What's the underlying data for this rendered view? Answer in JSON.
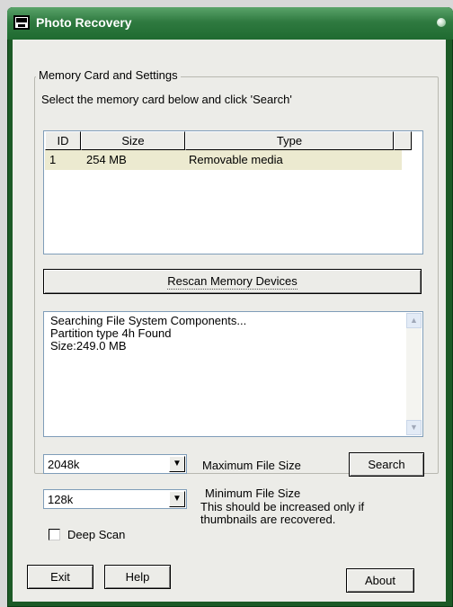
{
  "window": {
    "title": "Photo Recovery"
  },
  "group": {
    "legend": "Memory Card and Settings",
    "instruction": "Select the memory card below and click 'Search'"
  },
  "device_list": {
    "columns": [
      "ID",
      "Size",
      "Type"
    ],
    "rows": [
      {
        "id": "1",
        "size": "254 MB",
        "type": "Removable media"
      }
    ]
  },
  "rescan_button": "Rescan Memory Devices",
  "log": {
    "lines": [
      "Searching File System Components...",
      "Partition type  4h Found",
      "Size:249.0 MB"
    ]
  },
  "max_file_size": {
    "value": "2048k",
    "label": "Maximum File Size"
  },
  "min_file_size": {
    "value": "128k",
    "label": "Minimum File Size",
    "note_line1": "This should be increased only if",
    "note_line2": "thumbnails are recovered."
  },
  "deep_scan": {
    "label": "Deep Scan",
    "checked": false
  },
  "buttons": {
    "search": "Search",
    "exit": "Exit",
    "help": "Help",
    "about": "About"
  },
  "colors": {
    "titlebar": "#2f7a40",
    "frame": "#1c5a26",
    "client": "#ecece8",
    "selected_row": "#ecead0"
  }
}
